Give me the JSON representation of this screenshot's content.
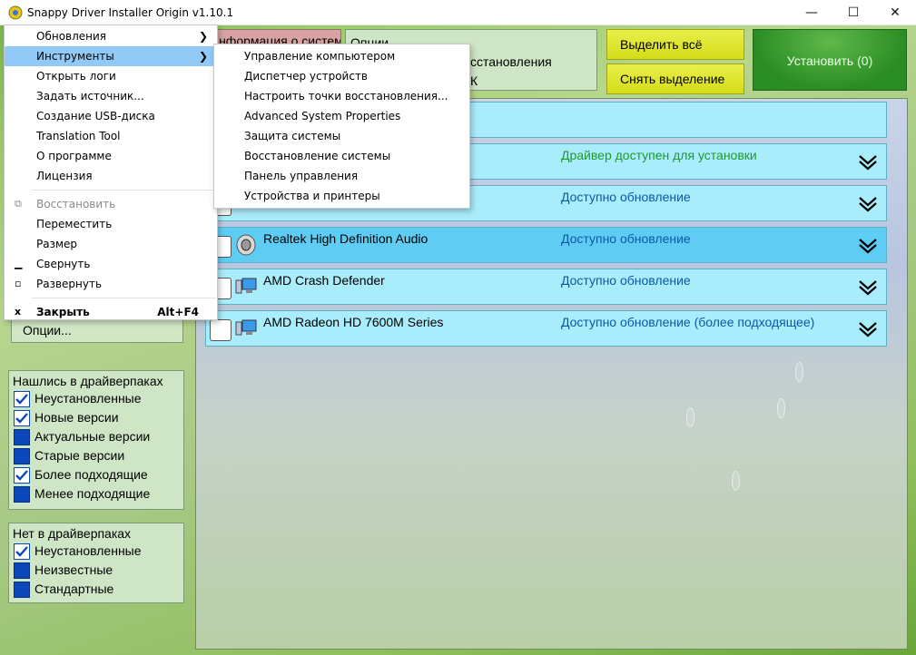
{
  "window": {
    "title": "Snappy Driver Installer Origin v1.10.1",
    "min_glyph": "—",
    "max_glyph": "☐",
    "close_glyph": "✕"
  },
  "toolbar": {
    "sysinfo_label": "Информация о системе",
    "options_title": "Опции",
    "options_line2": "сстановления",
    "options_line3": "К",
    "select_all": "Выделить всё",
    "deselect": "Снять выделение",
    "install": "Установить (0)"
  },
  "drivers": [
    {
      "name": "",
      "status": "Драйвер доступен для установки",
      "status_color": "#1f9a2c",
      "selected": false
    },
    {
      "name": "",
      "status": "Доступно обновление",
      "status_color": "#0c58a8",
      "selected": false
    },
    {
      "name": "Realtek High Definition Audio",
      "status": "Доступно обновление",
      "status_color": "#0c58a8",
      "selected": true,
      "icon": "speaker-icon"
    },
    {
      "name": "AMD Crash Defender",
      "status": "Доступно обновление",
      "status_color": "#0c58a8",
      "selected": false,
      "icon": "monitor-icon"
    },
    {
      "name": "AMD Radeon HD 7600M Series",
      "status": "Доступно обновление (более подходящее)",
      "status_color": "#0c58a8",
      "selected": false,
      "icon": "monitor-icon"
    }
  ],
  "left": {
    "options_button": "Опции...",
    "found_panel": {
      "title": "Нашлись в драйверпаках",
      "items": [
        {
          "label": "Неустановленные",
          "checked": true
        },
        {
          "label": "Новые версии",
          "checked": true
        },
        {
          "label": "Актуальные версии",
          "checked": false
        },
        {
          "label": "Старые версии",
          "checked": false
        },
        {
          "label": "Более подходящие",
          "checked": true
        },
        {
          "label": "Менее подходящие",
          "checked": false
        }
      ]
    },
    "notfound_panel": {
      "title": "Нет в драйверпаках",
      "items": [
        {
          "label": "Неустановленные",
          "checked": true
        },
        {
          "label": "Неизвестные",
          "checked": false
        },
        {
          "label": "Стандартные",
          "checked": false
        }
      ]
    }
  },
  "main_menu": {
    "items": [
      {
        "label": "Обновления",
        "submenu": true
      },
      {
        "label": "Инструменты",
        "submenu": true,
        "highlighted": true
      },
      {
        "label": "Открыть логи"
      },
      {
        "label": "Задать источник..."
      },
      {
        "label": "Создание USB-диска"
      },
      {
        "label": "Translation Tool"
      },
      {
        "label": "О программе"
      },
      {
        "label": "Лицензия"
      }
    ],
    "window_items": [
      {
        "label": "Восстановить",
        "disabled": true,
        "glyph": "⧉"
      },
      {
        "label": "Переместить"
      },
      {
        "label": "Размер"
      },
      {
        "label": "Свернуть",
        "glyph": "▁"
      },
      {
        "label": "Развернуть",
        "glyph": "▫"
      }
    ],
    "close_item": {
      "label": "Закрыть",
      "accelerator": "Alt+F4",
      "glyph": "x"
    }
  },
  "tools_submenu": {
    "items": [
      {
        "label": "Управление компьютером"
      },
      {
        "label": "Диспетчер устройств"
      },
      {
        "label": "Настроить точки восстановления..."
      },
      {
        "label": "Advanced System Properties"
      },
      {
        "label": "Защита системы"
      },
      {
        "label": "Восстановление системы"
      },
      {
        "label": "Панель управления"
      },
      {
        "label": "Устройства и принтеры"
      }
    ]
  }
}
